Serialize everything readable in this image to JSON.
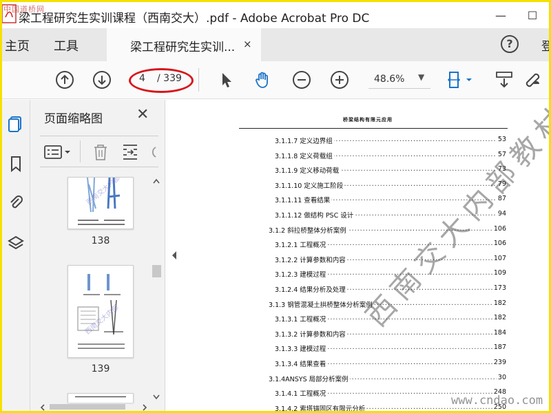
{
  "window": {
    "title": "梁工程研究生实训课程（西南交大）.pdf - Adobe Acrobat Pro DC",
    "watermark_corner": "中国道桥网",
    "minimize": "—",
    "maximize": "☐"
  },
  "menu": {
    "home": "主页",
    "tools": "工具",
    "tab_label": "梁工程研究生实训...",
    "tab_close": "×",
    "help": "?",
    "cut_text": "登"
  },
  "toolbar": {
    "page_current": "4",
    "page_total": "/ 339",
    "zoom": "48.6%",
    "zoom_caret": "▼"
  },
  "thumbnails": {
    "title": "页面缩略图",
    "close": "✕",
    "items": [
      {
        "label": "138"
      },
      {
        "label": "139"
      }
    ]
  },
  "document": {
    "header": "桥梁结构有限元应用",
    "toc": [
      {
        "label": "3.1.1.7 定义边界组",
        "page": "53",
        "level": 3
      },
      {
        "label": "3.1.1.8 定义荷载组",
        "page": "57",
        "level": 3
      },
      {
        "label": "3.1.1.9 定义移动荷载",
        "page": "73",
        "level": 3
      },
      {
        "label": "3.1.1.10 定义施工阶段",
        "page": "79",
        "level": 3
      },
      {
        "label": "3.1.1.11 查看结果",
        "page": "87",
        "level": 3
      },
      {
        "label": "3.1.1.12 做结构 PSC 设计",
        "page": "94",
        "level": 3
      },
      {
        "label": "3.1.2 斜拉桥整体分析案例",
        "page": "106",
        "level": 2
      },
      {
        "label": "3.1.2.1 工程概况",
        "page": "106",
        "level": 3
      },
      {
        "label": "3.1.2.2 计算参数和内容",
        "page": "107",
        "level": 3
      },
      {
        "label": "3.1.2.3 建模过程",
        "page": "109",
        "level": 3
      },
      {
        "label": "3.1.2.4 结果分析及处理",
        "page": "173",
        "level": 3
      },
      {
        "label": "3.1.3 钢管混凝土拱桥整体分析案例",
        "page": "182",
        "level": 2
      },
      {
        "label": "3.1.3.1 工程概况",
        "page": "182",
        "level": 3
      },
      {
        "label": "3.1.3.2 计算参数和内容",
        "page": "184",
        "level": 3
      },
      {
        "label": "3.1.3.3 建模过程",
        "page": "187",
        "level": 3
      },
      {
        "label": "3.1.3.4 结果查看",
        "page": "239",
        "level": 3
      },
      {
        "label": "3.1.4ANSYS 局部分析案例",
        "page": "30",
        "level": 2
      },
      {
        "label": "3.1.4.1 工程概况",
        "page": "248",
        "level": 3
      },
      {
        "label": "3.1.4.2 索塔锚固区有限元分析",
        "page": "250",
        "level": 3
      }
    ],
    "watermark": "西南交大内部教材",
    "site_watermark": "www.cndao.com"
  }
}
